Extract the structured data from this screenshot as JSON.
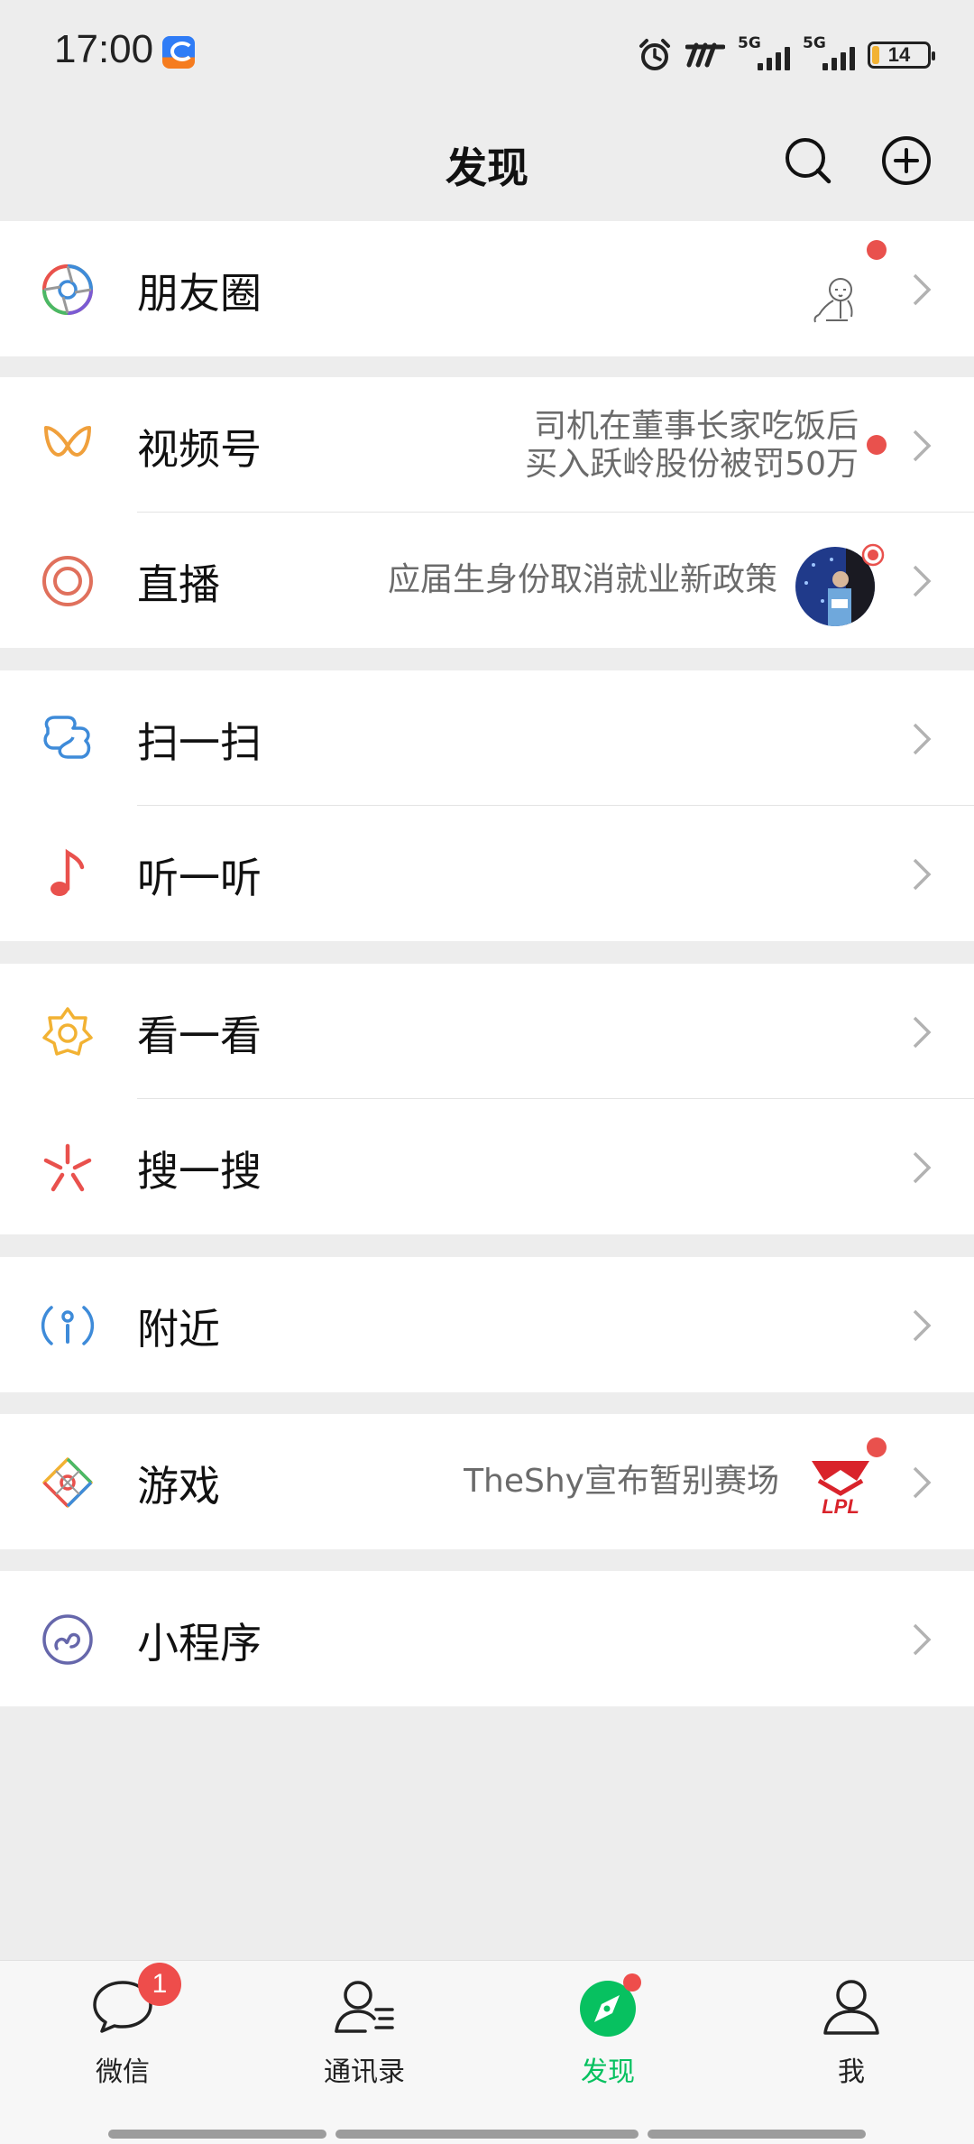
{
  "status": {
    "time": "17:00",
    "sig1": "5G",
    "sig2": "5G",
    "battery": "14"
  },
  "header": {
    "title": "发现"
  },
  "rows": {
    "moments": {
      "label": "朋友圈"
    },
    "channels": {
      "label": "视频号",
      "sub1": "司机在董事长家吃饭后",
      "sub2": "买入跃岭股份被罚50万"
    },
    "live": {
      "label": "直播",
      "sub": "应届生身份取消就业新政策"
    },
    "scan": {
      "label": "扫一扫"
    },
    "listen": {
      "label": "听一听"
    },
    "look": {
      "label": "看一看"
    },
    "search": {
      "label": "搜一搜"
    },
    "nearby": {
      "label": "附近"
    },
    "games": {
      "label": "游戏",
      "sub": "TheShy宣布暂别赛场",
      "logo_text": "LPL"
    },
    "mini": {
      "label": "小程序"
    }
  },
  "tabs": [
    {
      "label": "微信",
      "badge": "1"
    },
    {
      "label": "通讯录"
    },
    {
      "label": "发现"
    },
    {
      "label": "我"
    }
  ],
  "colors": {
    "accent": "#07c160",
    "badge": "#e9514d",
    "background": "#ededed"
  }
}
